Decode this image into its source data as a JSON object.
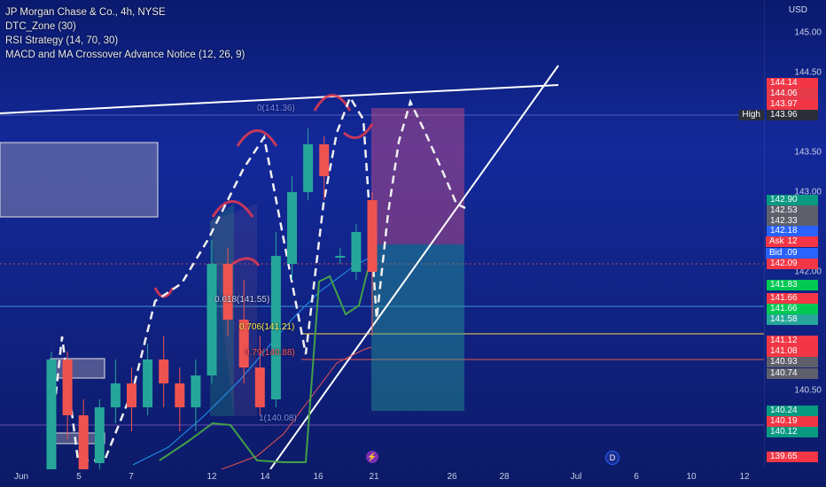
{
  "legend": {
    "title": "JP Morgan Chase & Co., 4h, NYSE",
    "indicator_1": "DTC_Zone (30)",
    "indicator_2": "RSI Strategy (14, 70, 30)",
    "indicator_3": "MACD and MA Crossover Advance Notice (12, 26, 9)"
  },
  "price_axis": {
    "currency": "USD",
    "levels": [
      "145.00",
      "144.50",
      "143.50",
      "143.00",
      "142.00",
      "140.50"
    ],
    "high_label": "High"
  },
  "price_tags": [
    {
      "price": "144.14",
      "color": "#f23645"
    },
    {
      "price": "144.06",
      "color": "#e53a4a"
    },
    {
      "price": "143.97",
      "color": "#f23645"
    },
    {
      "price": "143.96",
      "color": "#2a2e39"
    },
    {
      "price": "142.90",
      "color": "#089981"
    },
    {
      "price": "142.53",
      "color": "#5d606b"
    },
    {
      "price": "142.33",
      "color": "#5d606b"
    },
    {
      "price": "142.18",
      "color": "#2962ff"
    },
    {
      "price": "142.12",
      "color": "#f23645"
    },
    {
      "price": "142.09",
      "color": "#2962ff"
    },
    {
      "price": "142.09",
      "color": "#f23645"
    },
    {
      "price": "141.83",
      "color": "#00c853"
    },
    {
      "price": "141.66",
      "color": "#f23645"
    },
    {
      "price": "141.66",
      "color": "#00c853"
    },
    {
      "price": "141.58",
      "color": "#26a69a"
    },
    {
      "price": "141.12",
      "color": "#f23645"
    },
    {
      "price": "141.08",
      "color": "#f23645"
    },
    {
      "price": "140.93",
      "color": "#5d606b"
    },
    {
      "price": "140.74",
      "color": "#5d606b"
    },
    {
      "price": "140.24",
      "color": "#089981"
    },
    {
      "price": "140.19",
      "color": "#f23645"
    },
    {
      "price": "140.12",
      "color": "#089981"
    },
    {
      "price": "139.65",
      "color": "#f23645"
    }
  ],
  "quote": {
    "ask_label": "Ask",
    "bid_label": "Bid"
  },
  "time_axis": [
    "Jun",
    "5",
    "7",
    "12",
    "14",
    "16",
    "21",
    "26",
    "28",
    "Jul",
    "6",
    "10",
    "12"
  ],
  "fib_levels": [
    {
      "label": "0.618(141.55)",
      "color": "#c8d6ff"
    },
    {
      "label": "0.706(141.21)",
      "color": "#ffee58"
    },
    {
      "label": "0.79(140.88)",
      "color": "#ff5b6b"
    },
    {
      "label": "1(140.08)",
      "color": "#7e8cff"
    },
    {
      "label": "0(141.36)",
      "color": "#7e8cff"
    }
  ],
  "events": [
    {
      "icon": "lightning-icon",
      "symbol": "⚡",
      "color": "#7b2fb3"
    },
    {
      "icon": "dividend-icon",
      "symbol": "D",
      "color": "#2962ff"
    }
  ],
  "candles": [
    {
      "o": 139.2,
      "c": 140.9,
      "h": 141.0,
      "l": 139.1
    },
    {
      "o": 140.9,
      "c": 140.2,
      "h": 141.0,
      "l": 139.9
    },
    {
      "o": 140.2,
      "c": 139.5,
      "h": 140.4,
      "l": 139.2
    },
    {
      "o": 139.6,
      "c": 140.3,
      "h": 140.4,
      "l": 139.4
    },
    {
      "o": 140.3,
      "c": 140.6,
      "h": 140.9,
      "l": 140.1
    },
    {
      "o": 140.6,
      "c": 140.3,
      "h": 140.8,
      "l": 140.0
    },
    {
      "o": 140.3,
      "c": 140.9,
      "h": 141.1,
      "l": 140.2
    },
    {
      "o": 140.9,
      "c": 140.6,
      "h": 141.2,
      "l": 140.3
    },
    {
      "o": 140.6,
      "c": 140.3,
      "h": 140.8,
      "l": 140.0
    },
    {
      "o": 140.3,
      "c": 140.7,
      "h": 140.9,
      "l": 140.0
    },
    {
      "o": 140.7,
      "c": 142.1,
      "h": 142.4,
      "l": 140.6
    },
    {
      "o": 142.1,
      "c": 141.4,
      "h": 142.3,
      "l": 141.2
    },
    {
      "o": 141.4,
      "c": 140.8,
      "h": 141.9,
      "l": 140.6
    },
    {
      "o": 140.8,
      "c": 140.3,
      "h": 141.2,
      "l": 140.2
    },
    {
      "o": 140.4,
      "c": 142.2,
      "h": 142.5,
      "l": 140.3
    },
    {
      "o": 142.1,
      "c": 143.0,
      "h": 143.2,
      "l": 141.9
    },
    {
      "o": 143.0,
      "c": 143.6,
      "h": 143.8,
      "l": 142.9
    },
    {
      "o": 143.6,
      "c": 143.2,
      "h": 143.7,
      "l": 142.9
    },
    {
      "o": 142.2,
      "c": 142.2,
      "h": 142.3,
      "l": 142.1
    },
    {
      "o": 142.0,
      "c": 142.5,
      "h": 142.6,
      "l": 141.9
    },
    {
      "o": 142.9,
      "c": 142.0,
      "h": 143.0,
      "l": 141.2
    }
  ]
}
